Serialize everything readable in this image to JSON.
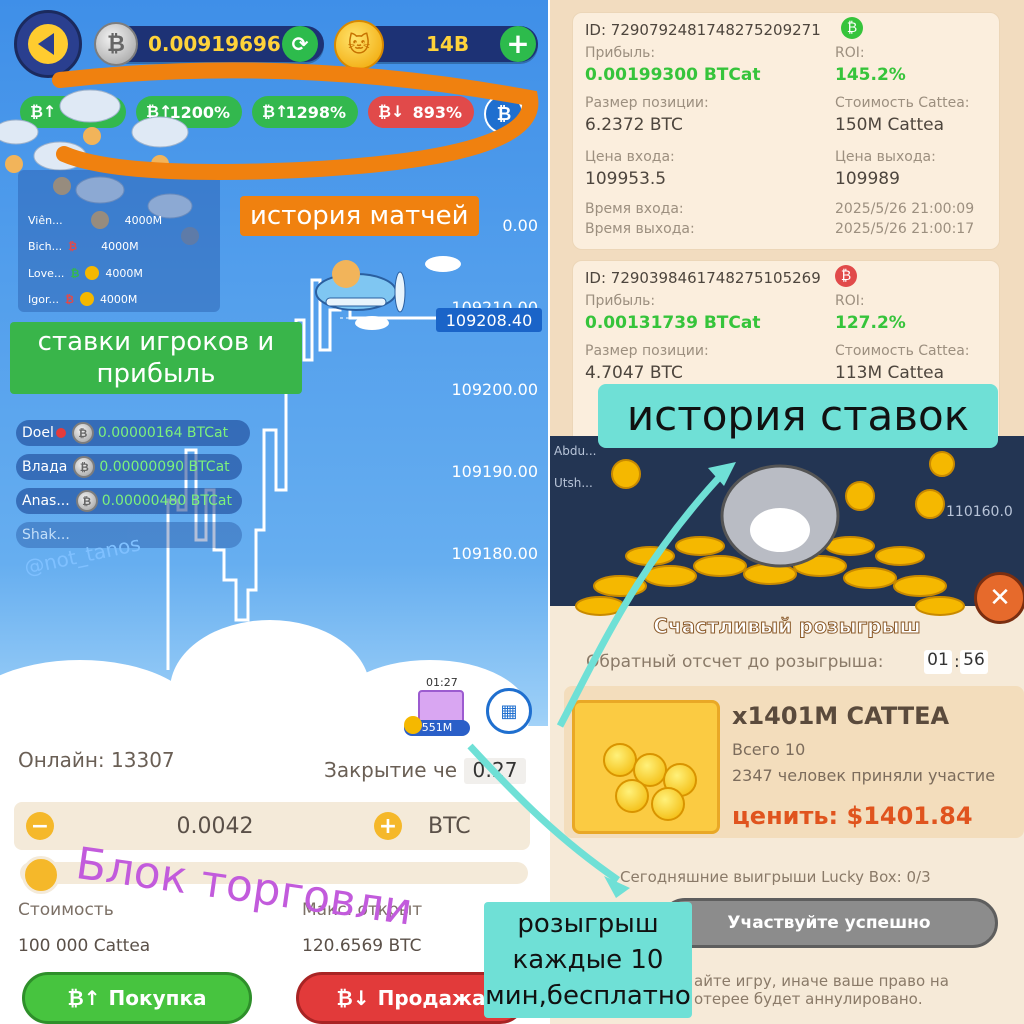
{
  "header": {
    "btc_balance": "0.00919696",
    "cattea_balance": "14B"
  },
  "roi_badges": [
    "1200%",
    "1200%",
    "1298%",
    "893%"
  ],
  "mini_board": {
    "rows": [
      {
        "name": "Viên...",
        "amount": "4000M"
      },
      {
        "name": "Bich...",
        "amount": "4000M"
      },
      {
        "name": "Love...",
        "amount": "4000M"
      },
      {
        "name": "Igor...",
        "amount": "4000M"
      }
    ]
  },
  "chart": {
    "current_price": "109208.40",
    "ticks": [
      "0.00",
      "109210.00",
      "109200.00",
      "109190.00",
      "109180.00"
    ]
  },
  "players": [
    {
      "name": "Doel",
      "amount": "0.00000164 BTCat"
    },
    {
      "name": "Влада",
      "amount": "0.00000090 BTCat"
    },
    {
      "name": "Anas...",
      "amount": "0.00000480 BTCat"
    },
    {
      "name": "Shak...",
      "amount": ""
    }
  ],
  "watermark": "@not_tanos",
  "box_timer": "01:27",
  "box_amount": "551M",
  "trade": {
    "online_label": "Онлайн: 13307",
    "closing_label": "Закрытие че",
    "closing_time": "0:27",
    "amount": "0.0042",
    "currency": "BTC",
    "cost_label": "Стоимость",
    "cost_value": "100 000 Cattea",
    "max_label": "Макс. открыт",
    "max_value": "120.6569 BTC",
    "buy_label": "Покупка",
    "sell_label": "Продажа"
  },
  "annotations": {
    "match_history": "история матчей",
    "player_bets": "ставки игроков и прибыль",
    "trade_block": "Блок торговли",
    "bet_history": "история ставок",
    "lottery": "розыгрыш каждые 10 мин,бесплатно"
  },
  "history": {
    "cards": [
      {
        "id": "ID: 7290792481748275209271",
        "profit_label": "Прибыль:",
        "profit": "0.00199300 BTCat",
        "roi_label": "ROI:",
        "roi": "145.2%",
        "size_label": "Размер позиции:",
        "size": "6.2372 BTC",
        "cost_label": "Стоимость Cattea:",
        "cost": "150M Cattea",
        "entry_label": "Цена входа:",
        "entry": "109953.5",
        "exit_label": "Цена выхода:",
        "exit": "109989",
        "entry_time_label": "Время входа:",
        "entry_time": "2025/5/26 21:00:09",
        "exit_time_label": "Время выхода:",
        "exit_time": "2025/5/26 21:00:17"
      },
      {
        "id": "ID: 7290398461748275105269",
        "profit_label": "Прибыль:",
        "profit": "0.00131739 BTCat",
        "roi_label": "ROI:",
        "roi": "127.2%",
        "size_label": "Размер позиции:",
        "size": "4.7047 BTC",
        "cost_label": "Стоимость Cattea:",
        "cost": "113M Cattea"
      }
    ]
  },
  "lucky": {
    "bg_left": "Abdu...",
    "bg_left2": "Utsh...",
    "bg_price": "110160.0",
    "title": "Счастливый розыгрыш",
    "countdown_label": "Обратный отсчет до розыгрыша:",
    "countdown_min": "01",
    "countdown_sec": "56",
    "prize_title": "x1401M CATTEA",
    "total": "Всего 10",
    "participants": "2347 человек приняли участие",
    "value": "ценить: $1401.84",
    "today": "Сегодняшние выигрыши Lucky Box: 0/3",
    "participate_button": "Участвуйте успешно",
    "warning_line1": "айте игру, иначе ваше право на",
    "warning_line2": "отерее будет аннулировано."
  },
  "colors": {
    "orange_annotation": "#f0810f",
    "green_annotation": "#39b54a",
    "cyan_annotation": "#6fe0d6",
    "purple_annotation": "#c25bdc",
    "buy_green": "#47c43f",
    "sell_red": "#e23a3a"
  }
}
